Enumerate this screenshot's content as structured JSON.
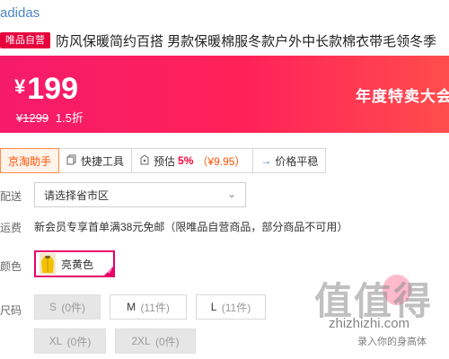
{
  "brand": "adidas",
  "title": {
    "badge": "唯品自营",
    "text": "防风保暖简约百搭 男款保暖棉服冬款户外中长款棉衣带毛领冬季"
  },
  "price": {
    "symbol": "¥",
    "current": "199",
    "original": "¥1299",
    "discount": "1.5折",
    "promo": "年度特卖大会"
  },
  "toolbar": {
    "jd_helper": "京淘助手",
    "quick_tools": "快捷工具",
    "estimate_label": "预估",
    "estimate_pct": "5%",
    "estimate_amount": "（¥9.95）",
    "price_trend": "价格平稳"
  },
  "delivery": {
    "label": "配送",
    "placeholder": "请选择省市区"
  },
  "shipping": {
    "label": "运费",
    "text": "新会员专享首单满38元免邮（限唯品自营商品，部分商品不可用）"
  },
  "color": {
    "label": "颜色",
    "selected": "亮黄色"
  },
  "size": {
    "label": "尺码",
    "options": [
      {
        "size": "S",
        "stock": "(0件)",
        "available": false
      },
      {
        "size": "M",
        "stock": "(11件)",
        "available": true
      },
      {
        "size": "L",
        "stock": "(11件)",
        "available": true
      },
      {
        "size": "XL",
        "stock": "(0件)",
        "available": false
      },
      {
        "size": "2XL",
        "stock": "(0件)",
        "available": false
      }
    ]
  },
  "watermark": {
    "big": "值值得",
    "url": "zhizhizhi.com",
    "sub": "录入你的身高体"
  },
  "colors": {
    "accent": "#ff2258",
    "badge": "#e6003c",
    "selected_border": "#e6006b",
    "brand_link": "#4a86c8"
  }
}
